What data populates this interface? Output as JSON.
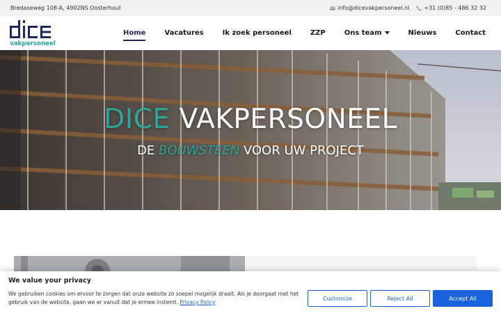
{
  "topbar": {
    "address": "Bredaseweg 108-A, 4902NS Oosterhout",
    "email": "info@dicevakpersoneel.nl",
    "phone": "+31 (0)85 - 486 32 32"
  },
  "logo": {
    "main": "dice",
    "sub": "vakpersoneel"
  },
  "nav": {
    "items": [
      {
        "label": "Home"
      },
      {
        "label": "Vacatures"
      },
      {
        "label": "Ik zoek personeel"
      },
      {
        "label": "ZZP"
      },
      {
        "label": "Ons team"
      },
      {
        "label": "Nieuws"
      },
      {
        "label": "Contact"
      }
    ]
  },
  "hero": {
    "title_accent": "DICE",
    "title_rest": " VAKPERSONEEL",
    "sub_pre": "DE ",
    "sub_accent": "BOUWSTEEN",
    "sub_post": " VOOR UW PROJECT"
  },
  "cookie": {
    "title": "We value your privacy",
    "text": "We gebruiken cookies om ervoor te zorgen dat onze website zo soepel mogelijk draait. Als je doorgaat met het gebruik van de website, gaan we er vanuit dat je ermee instemt.",
    "link": "Privacy Policy",
    "customize": "Customize",
    "reject": "Reject All",
    "accept": "Accept All"
  },
  "colors": {
    "accent": "#2ea59a",
    "navy": "#1d2a5c",
    "cookie_blue": "#1863dc"
  },
  "icons": {
    "email": "envelope-icon",
    "phone": "phone-icon",
    "dropdown": "chevron-down-icon"
  }
}
